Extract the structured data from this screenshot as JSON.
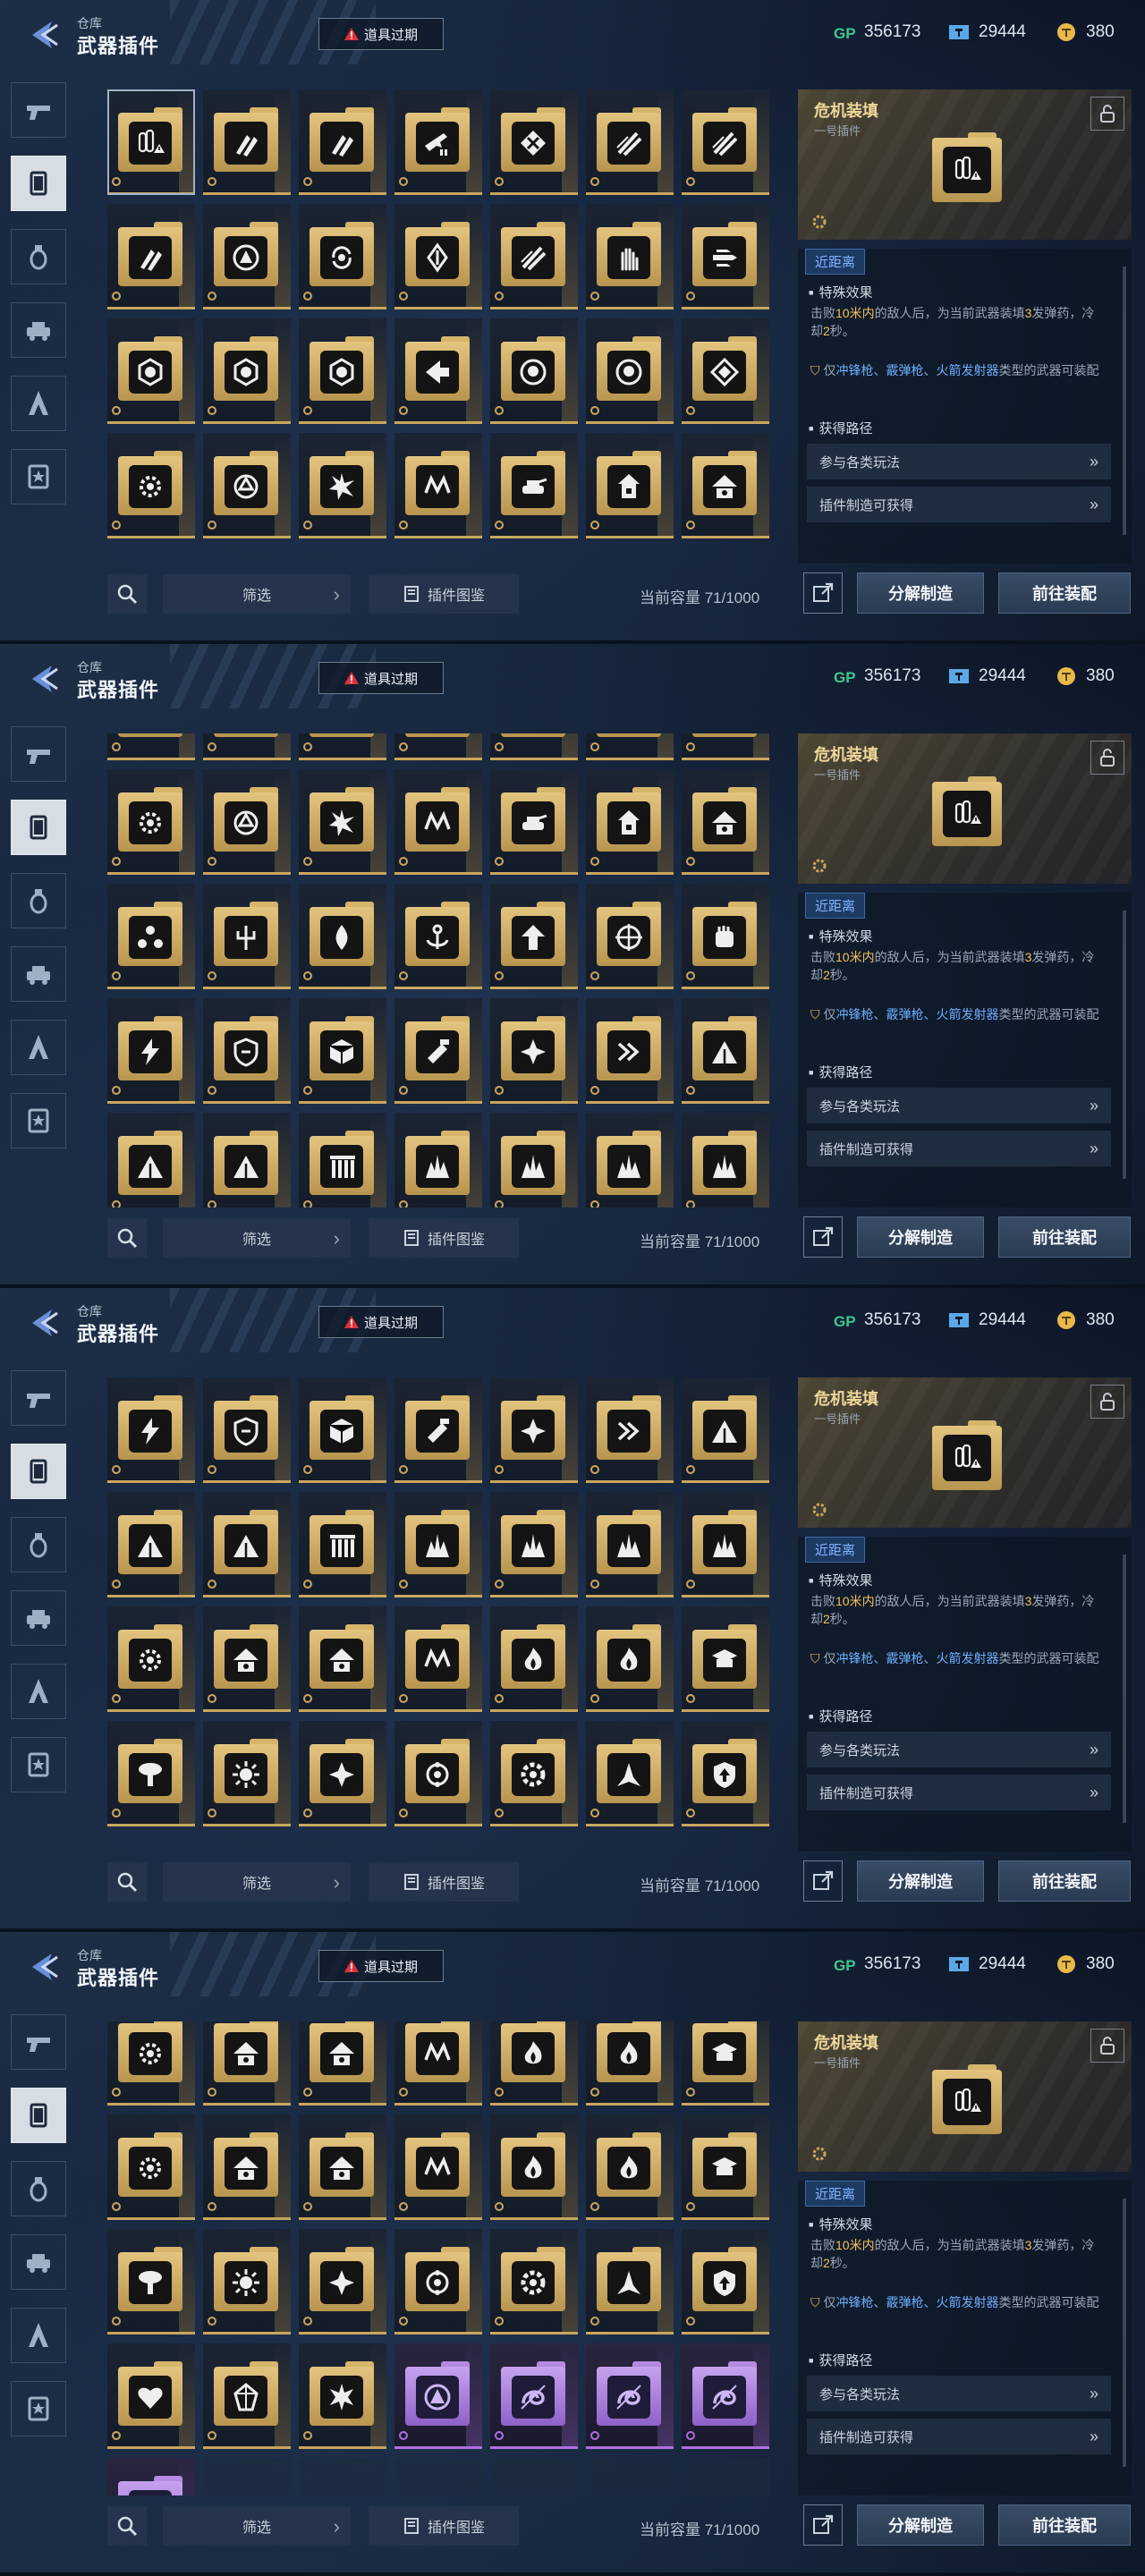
{
  "header": {
    "breadcrumb": "仓库",
    "title": "武器插件",
    "expired_button": "道具过期",
    "currencies": [
      {
        "icon": "gp-currency-icon",
        "value": "356173"
      },
      {
        "icon": "ticket-currency-icon",
        "value": "29444"
      },
      {
        "icon": "gold-coin-currency-icon",
        "value": "380"
      }
    ]
  },
  "rail_tabs": [
    {
      "icon": "pistol-icon"
    },
    {
      "icon": "weapon-plugin-icon",
      "active": true
    },
    {
      "icon": "grenade-icon"
    },
    {
      "icon": "vehicle-icon"
    },
    {
      "icon": "tower-icon"
    },
    {
      "icon": "badge-icon"
    }
  ],
  "colors": {
    "gold": "#c9a65f",
    "purple": "#b16fe0",
    "highlight_yellow": "#f1c25c",
    "highlight_blue": "#6fb0ff"
  },
  "detail": {
    "name": "危机装填",
    "subtitle": "一号插件",
    "range_tag": "近距离",
    "effect_heading": "特殊效果",
    "effect_parts": [
      "击败",
      "10米内",
      "的敌人后，为当前武器装填",
      "3",
      "发弹药，冷却",
      "2",
      "秒。"
    ],
    "restrict_parts": [
      "仅",
      "冲锋枪、霰弹枪、火箭发射器",
      "类型的武器可装配"
    ],
    "route_heading": "获得路径",
    "routes": [
      "参与各类玩法",
      "插件制造可获得"
    ]
  },
  "bottom": {
    "filter": "筛选",
    "codex": "插件图鉴",
    "capacity": "当前容量 71/1000",
    "dismantle": "分解制造",
    "equip": "前往装配"
  }
}
